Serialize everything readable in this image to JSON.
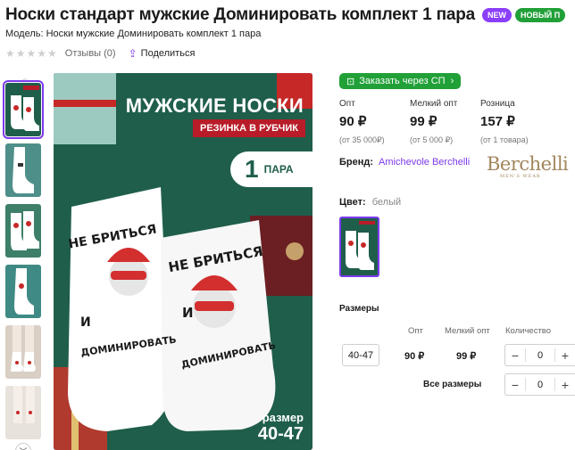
{
  "product": {
    "title": "Носки стандарт мужские Доминировать комплект 1 пара",
    "badges": [
      "NEW",
      "НОВЫЙ П"
    ],
    "model": "Модель: Носки мужские Доминировать комплект 1 пара",
    "reviews": "Отзывы (0)",
    "share": "Поделиться",
    "stars": "★★★★★"
  },
  "image": {
    "headline": "МУЖСКИЕ НОСКИ",
    "ribbon": "РЕЗИНКА В РУБЧИК",
    "pack_count": "1",
    "pack_label": "ПАРА",
    "sock_text_1": "НЕ БРИТЬСЯ",
    "sock_text_2": "И",
    "sock_text_3": "ДОМИНИРОВАТЬ",
    "size_label": "размер",
    "size_value": "40-47"
  },
  "order_button": "Заказать через СП",
  "prices": [
    {
      "label": "Опт",
      "value": "90 ₽",
      "sub": "(от 35 000₽)"
    },
    {
      "label": "Мелкий опт",
      "value": "99 ₽",
      "sub": "(от 5 000 ₽)"
    },
    {
      "label": "Розница",
      "value": "157 ₽",
      "sub": "(от 1 товара)"
    }
  ],
  "brand": {
    "label": "Бренд:",
    "name": "Amichevole Berchelli",
    "logo": "Berchelli",
    "logo_sub": "MEN'S WEAR"
  },
  "color": {
    "label": "Цвет:",
    "value": "белый"
  },
  "sizes": {
    "title": "Размеры",
    "headers": {
      "opt": "Опт",
      "small_opt": "Мелкий опт",
      "qty": "Количество"
    },
    "rows": [
      {
        "size": "40-47",
        "opt": "90 ₽",
        "small_opt": "99 ₽",
        "qty": "0"
      }
    ],
    "all_label": "Все размеры",
    "all_qty": "0"
  },
  "colors": {
    "accent": "#7c3aed",
    "green": "#21a038",
    "hero_bg": "#1f5e4b",
    "red": "#b71c28"
  }
}
